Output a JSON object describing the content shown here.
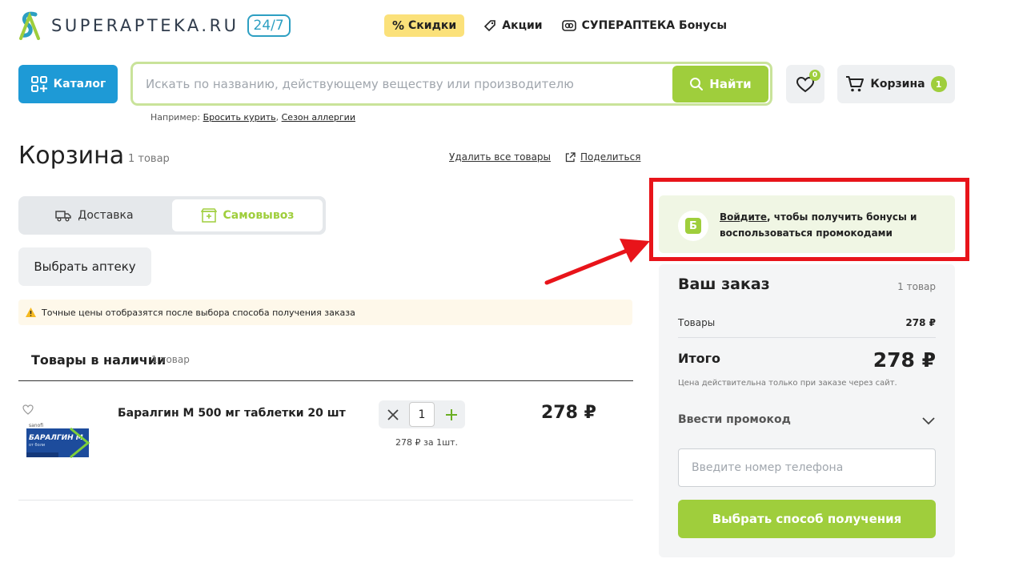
{
  "header": {
    "logo_text": "SUPERAPTEKA.RU",
    "logo_badge": "24/7",
    "nav": [
      {
        "label": "Скидки",
        "icon": "percent-icon"
      },
      {
        "label": "Акции",
        "icon": "tag-icon"
      },
      {
        "label": "СУПЕРАПТЕКА Бонусы",
        "icon": "bonus-card-icon"
      }
    ]
  },
  "search": {
    "catalog_label": "Каталог",
    "placeholder": "Искать по названию, действующему веществу или производителю",
    "button_label": "Найти",
    "hint_prefix": "Например:",
    "hint_links": [
      "Бросить курить",
      "Сезон аллергии"
    ]
  },
  "favorites": {
    "count": "0"
  },
  "cart_button": {
    "label": "Корзина",
    "count": "1"
  },
  "cart": {
    "title": "Корзина",
    "count": "1 товар",
    "delete_all": "Удалить все товары",
    "share": "Поделиться"
  },
  "delivery": {
    "tabs": [
      {
        "label": "Доставка",
        "active": false
      },
      {
        "label": "Самовывоз",
        "active": true
      }
    ],
    "choose_pharmacy": "Выбрать аптеку",
    "notice": "Точные цены отобразятся после выбора способа получения заказа"
  },
  "in_stock": {
    "title": "Товары в наличии",
    "count": "1 товар",
    "items": [
      {
        "name": "Баралгин М 500 мг таблетки 20 шт",
        "quantity": "1",
        "unit_price": "278 ₽ за 1шт.",
        "price": "278 ₽",
        "package_brand": "sanofi",
        "package_name": "БАРАЛГИН М",
        "package_sub": "от боли"
      }
    ]
  },
  "bonus_banner": {
    "icon_letter": "Б",
    "link": "Войдите",
    "text": ", чтобы получить бонусы и воспользоваться промокодами"
  },
  "order": {
    "title": "Ваш заказ",
    "count": "1 товар",
    "goods_label": "Товары",
    "goods_price": "278 ₽",
    "total_label": "Итого",
    "total_price": "278 ₽",
    "note": "Цена действительна только при заказе через сайт.",
    "promo_label": "Ввести промокод",
    "phone_placeholder": "Введите номер телефона",
    "submit_label": "Выбрать способ получения"
  },
  "colors": {
    "brand_blue": "#1e9ad6",
    "accent_green": "#9fce3c",
    "highlight_red": "#e8141a",
    "sale_yellow": "#fbe17a"
  }
}
